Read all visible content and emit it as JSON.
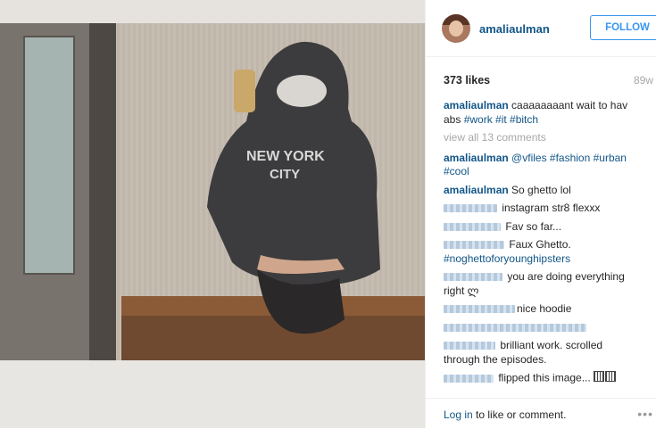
{
  "post": {
    "username": "amaliaulman",
    "follow_label": "FOLLOW",
    "likes": "373 likes",
    "age": "89w",
    "view_all_comments": "view all 13 comments",
    "login_link": "Log in",
    "login_suffix": " to like or comment.",
    "more_icon": "•••"
  },
  "caption": {
    "user": "amaliaulman",
    "text": " caaaaaaaant wait to hav abs ",
    "tags": "#work #it #bitch"
  },
  "comments": [
    {
      "user": "amaliaulman",
      "text": " ",
      "tags": "@vfiles #fashion #urban #cool"
    },
    {
      "user": "amaliaulman",
      "text": " So ghetto lol"
    },
    {
      "text": " instagram str8 flexxx"
    },
    {
      "text": " Fav so far..."
    },
    {
      "text": " Faux Ghetto. ",
      "tags": "#noghettoforyounghipsters"
    },
    {
      "text": " you are doing everything right ლ"
    },
    {
      "text": "nice hoodie"
    },
    {
      "text": ""
    },
    {
      "text": " brilliant work. scrolled through the episodes."
    },
    {
      "text": " flipped this image... "
    }
  ],
  "colors": {
    "link": "#125688",
    "follow": "#3897f0",
    "muted": "#a5a7aa"
  },
  "icons": {
    "avatar": "avatar",
    "more": "more-options-icon"
  }
}
